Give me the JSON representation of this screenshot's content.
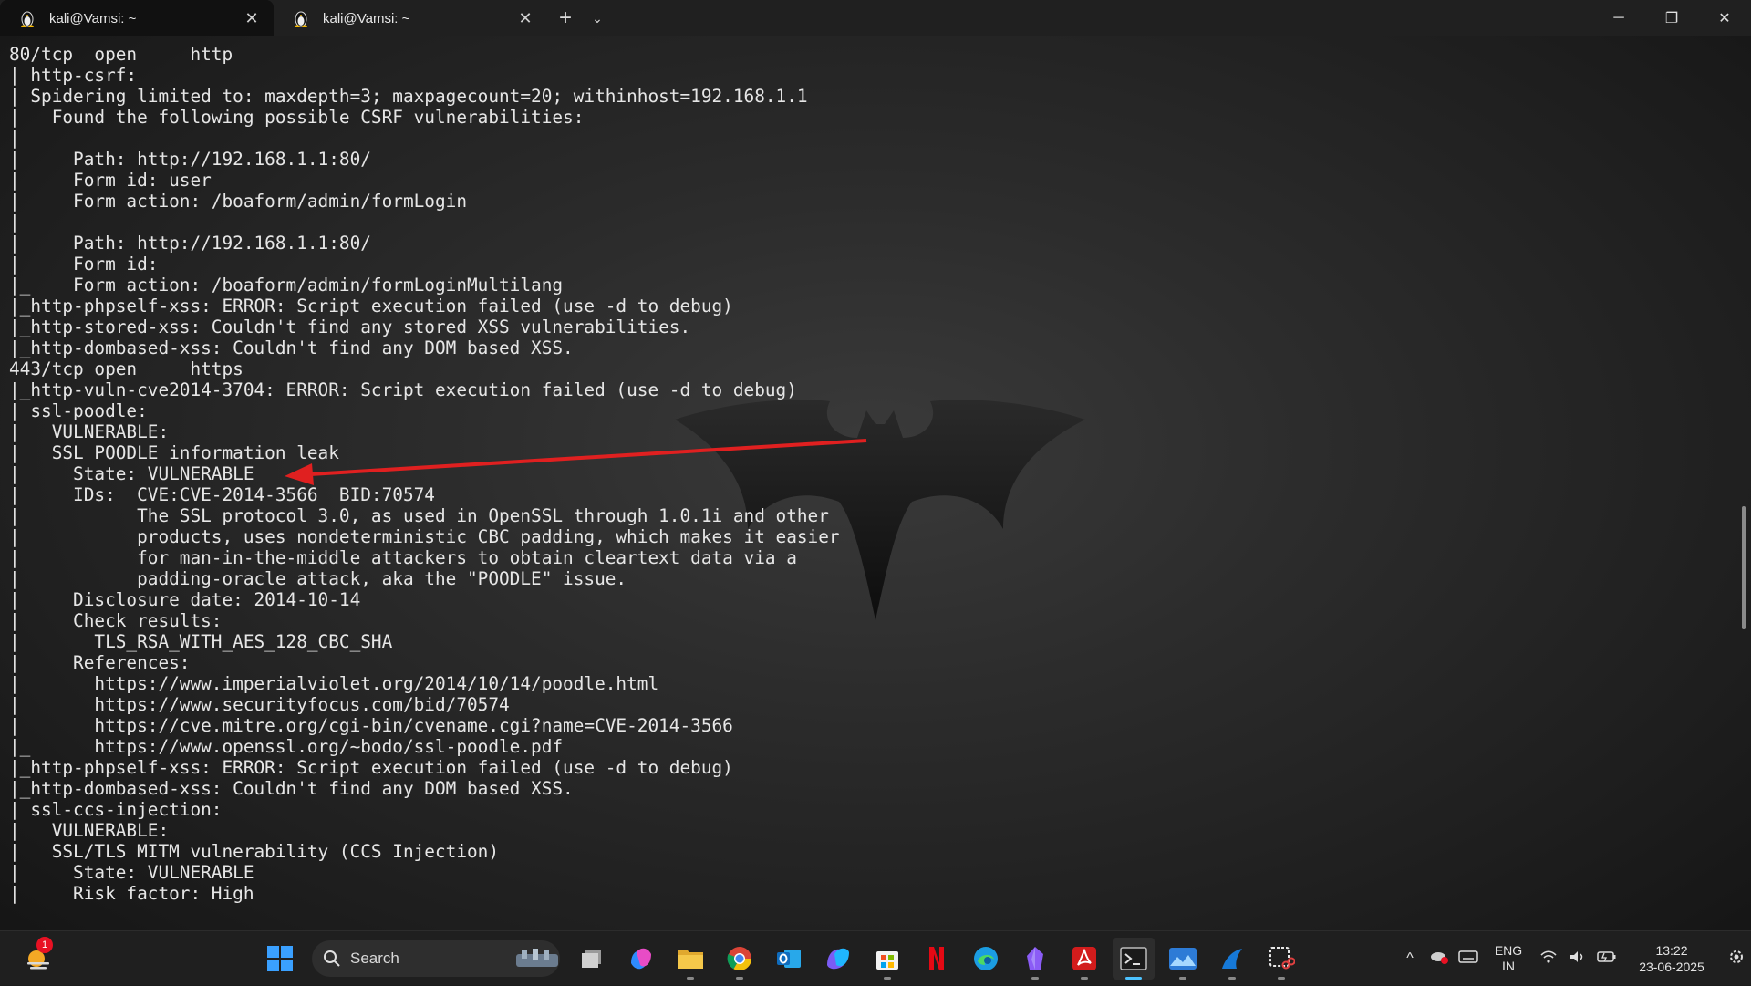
{
  "tabs": [
    {
      "title": "kali@Vamsi: ~",
      "active": true
    },
    {
      "title": "kali@Vamsi: ~",
      "active": false
    }
  ],
  "tab_controls": {
    "new_tab": "+",
    "dropdown": "⌄",
    "close": "✕"
  },
  "window_controls": {
    "minimize": "─",
    "maximize": "❐",
    "close": "✕"
  },
  "terminal": {
    "lines": [
      "80/tcp  open     http",
      "| http-csrf:",
      "| Spidering limited to: maxdepth=3; maxpagecount=20; withinhost=192.168.1.1",
      "|   Found the following possible CSRF vulnerabilities:",
      "|",
      "|     Path: http://192.168.1.1:80/",
      "|     Form id: user",
      "|     Form action: /boaform/admin/formLogin",
      "|",
      "|     Path: http://192.168.1.1:80/",
      "|     Form id:",
      "|_    Form action: /boaform/admin/formLoginMultilang",
      "|_http-phpself-xss: ERROR: Script execution failed (use -d to debug)",
      "|_http-stored-xss: Couldn't find any stored XSS vulnerabilities.",
      "|_http-dombased-xss: Couldn't find any DOM based XSS.",
      "443/tcp open     https",
      "|_http-vuln-cve2014-3704: ERROR: Script execution failed (use -d to debug)",
      "| ssl-poodle:",
      "|   VULNERABLE:",
      "|   SSL POODLE information leak",
      "|     State: VULNERABLE",
      "|     IDs:  CVE:CVE-2014-3566  BID:70574",
      "|           The SSL protocol 3.0, as used in OpenSSL through 1.0.1i and other",
      "|           products, uses nondeterministic CBC padding, which makes it easier",
      "|           for man-in-the-middle attackers to obtain cleartext data via a",
      "|           padding-oracle attack, aka the \"POODLE\" issue.",
      "|     Disclosure date: 2014-10-14",
      "|     Check results:",
      "|       TLS_RSA_WITH_AES_128_CBC_SHA",
      "|     References:",
      "|       https://www.imperialviolet.org/2014/10/14/poodle.html",
      "|       https://www.securityfocus.com/bid/70574",
      "|       https://cve.mitre.org/cgi-bin/cvename.cgi?name=CVE-2014-3566",
      "|_      https://www.openssl.org/~bodo/ssl-poodle.pdf",
      "|_http-phpself-xss: ERROR: Script execution failed (use -d to debug)",
      "|_http-dombased-xss: Couldn't find any DOM based XSS.",
      "| ssl-ccs-injection:",
      "|   VULNERABLE:",
      "|   SSL/TLS MITM vulnerability (CCS Injection)",
      "|     State: VULNERABLE",
      "|     Risk factor: High"
    ],
    "arrow_color": "#e02020"
  },
  "taskbar": {
    "weather_badge": "1",
    "search_label": "Search",
    "pinned": [
      {
        "name": "start",
        "icon": "windows-icon"
      },
      {
        "name": "task-view",
        "icon": "task-view-icon"
      },
      {
        "name": "copilot",
        "icon": "copilot-icon"
      },
      {
        "name": "file-explorer",
        "icon": "folder-icon"
      },
      {
        "name": "chrome",
        "icon": "chrome-icon"
      },
      {
        "name": "outlook",
        "icon": "outlook-icon"
      },
      {
        "name": "m365",
        "icon": "m365-icon"
      },
      {
        "name": "store",
        "icon": "store-icon"
      },
      {
        "name": "netflix",
        "icon": "netflix-icon"
      },
      {
        "name": "edge",
        "icon": "edge-icon"
      },
      {
        "name": "obsidian",
        "icon": "obsidian-icon"
      },
      {
        "name": "acrobat",
        "icon": "acrobat-icon"
      },
      {
        "name": "terminal",
        "icon": "terminal-icon"
      },
      {
        "name": "photos",
        "icon": "photos-icon"
      },
      {
        "name": "wireshark",
        "icon": "wireshark-icon"
      },
      {
        "name": "snipping-tool",
        "icon": "snipping-icon"
      }
    ],
    "tray": {
      "lang_line1": "ENG",
      "lang_line2": "IN",
      "time": "13:22",
      "date": "23-06-2025"
    }
  }
}
